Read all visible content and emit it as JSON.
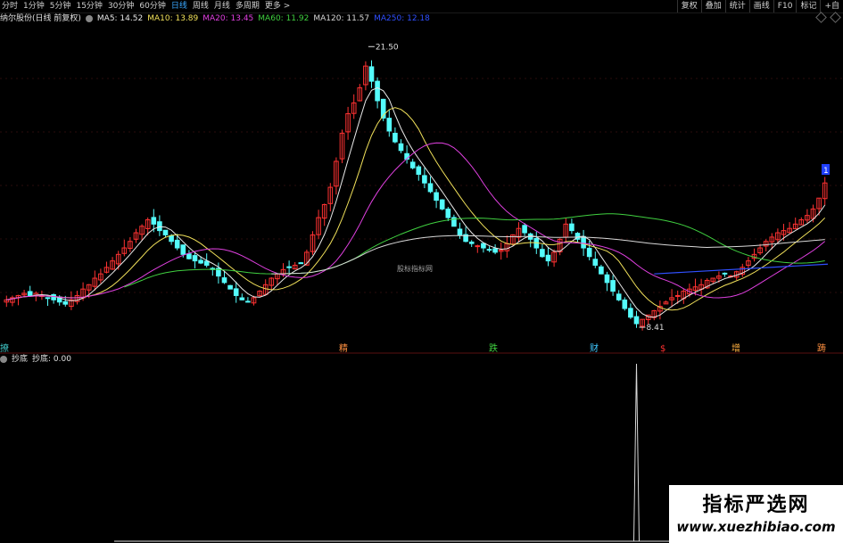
{
  "toolbar": {
    "periods": [
      "分时",
      "1分钟",
      "5分钟",
      "15分钟",
      "30分钟",
      "60分钟",
      "日线",
      "周线",
      "月线",
      "多周期",
      "更多 >"
    ],
    "active_period": "日线",
    "right_buttons": [
      "复权",
      "叠加",
      "统计",
      "画线",
      "F10",
      "标记",
      "+自"
    ]
  },
  "stock_title": "纳尔股份(日线 前复权)",
  "ma_legend": [
    {
      "label": "MA5: 14.52",
      "color": "#e8e8e8"
    },
    {
      "label": "MA10: 13.89",
      "color": "#f0e05a"
    },
    {
      "label": "MA20: 13.45",
      "color": "#e040e0"
    },
    {
      "label": "MA60: 11.92",
      "color": "#40d040"
    },
    {
      "label": "MA120: 11.57",
      "color": "#d8d8d8"
    },
    {
      "label": "MA250: 12.18",
      "color": "#3050ff"
    }
  ],
  "annotations": {
    "high": "21.50",
    "low": "8.41",
    "center_text": "股标指标网",
    "highlight_value": "1"
  },
  "signal_labels": [
    {
      "text": "撩",
      "color": "#40c8c8"
    },
    {
      "text": "精",
      "color": "#ff9040"
    },
    {
      "text": "跌",
      "color": "#40d040"
    },
    {
      "text": "财",
      "color": "#40c8ff"
    },
    {
      "text": "$",
      "color": "#ff3030"
    },
    {
      "text": "增",
      "color": "#ffb040"
    },
    {
      "text": "踌",
      "color": "#ff9040"
    }
  ],
  "subchart": {
    "name": "抄底",
    "value_label": "抄底: 0.00"
  },
  "watermark": {
    "line1": "指标严选网",
    "line2": "www.xuezhibiao.com"
  },
  "chart_data": {
    "type": "candlestick",
    "closes": [
      9.8,
      9.9,
      10.0,
      10.1,
      10.0,
      10.1,
      10.0,
      9.9,
      9.8,
      9.7,
      9.6,
      9.8,
      10.0,
      10.3,
      10.5,
      10.8,
      11.0,
      11.3,
      11.6,
      11.9,
      12.2,
      12.5,
      12.9,
      13.2,
      13.5,
      13.3,
      13.0,
      12.8,
      12.5,
      12.2,
      11.9,
      11.7,
      11.6,
      11.5,
      11.4,
      11.2,
      10.9,
      10.6,
      10.3,
      10.0,
      9.8,
      9.7,
      9.9,
      10.2,
      10.5,
      10.8,
      11.0,
      11.2,
      11.3,
      11.4,
      11.5,
      12.0,
      12.8,
      13.6,
      14.2,
      15.0,
      16.2,
      17.5,
      18.4,
      18.9,
      19.6,
      20.6,
      19.9,
      19.0,
      18.2,
      17.6,
      17.1,
      16.7,
      16.3,
      15.9,
      15.6,
      15.2,
      14.8,
      14.4,
      14.0,
      13.6,
      13.2,
      12.8,
      12.5,
      12.4,
      12.3,
      12.2,
      12.1,
      12.0,
      12.1,
      12.4,
      12.8,
      13.1,
      12.9,
      12.6,
      12.2,
      11.8,
      11.6,
      12.0,
      12.6,
      13.3,
      13.0,
      12.6,
      12.2,
      11.8,
      11.4,
      11.0,
      10.6,
      10.2,
      9.8,
      9.4,
      9.0,
      8.7,
      8.9,
      9.1,
      9.3,
      9.5,
      9.7,
      9.9,
      10.0,
      10.2,
      10.3,
      10.4,
      10.5,
      10.7,
      10.8,
      10.9,
      11.0,
      10.9,
      11.1,
      11.3,
      11.6,
      11.9,
      12.2,
      12.5,
      12.7,
      12.9,
      13.0,
      13.1,
      13.3,
      13.5,
      13.7,
      14.0,
      14.5,
      15.2
    ],
    "ma_series": [
      "MA5",
      "MA10",
      "MA20",
      "MA60",
      "MA120",
      "MA250"
    ],
    "ylim": [
      8.0,
      22.5
    ],
    "high_marker": 21.5,
    "low_marker": 8.41,
    "subchart_spike_index": 107
  }
}
